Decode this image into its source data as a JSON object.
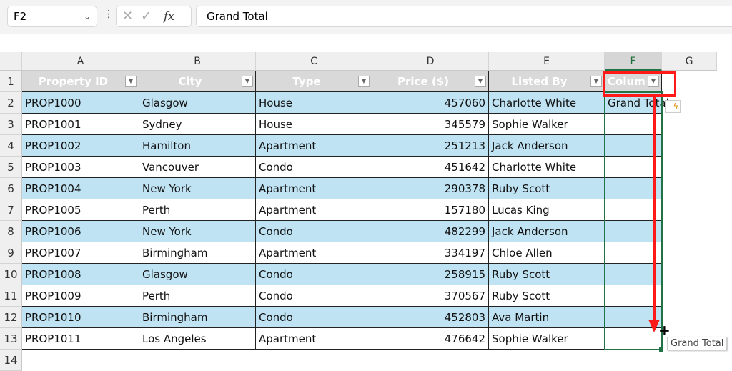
{
  "formula_bar": {
    "name_box": "F2",
    "formula": "Grand Total",
    "cancel_icon": "✕",
    "enter_icon": "✓",
    "fx_label": "fx"
  },
  "columns": [
    "A",
    "B",
    "C",
    "D",
    "E",
    "F",
    "G"
  ],
  "headers": [
    "Property ID",
    "City",
    "Type",
    "Price ($)",
    "Listed By",
    "Colum"
  ],
  "rows": [
    [
      "PROP1000",
      "Glasgow",
      "House",
      "457060",
      "Charlotte White",
      "Grand Total"
    ],
    [
      "PROP1001",
      "Sydney",
      "House",
      "345579",
      "Sophie Walker",
      ""
    ],
    [
      "PROP1002",
      "Hamilton",
      "Apartment",
      "251213",
      "Jack Anderson",
      ""
    ],
    [
      "PROP1003",
      "Vancouver",
      "Condo",
      "451642",
      "Charlotte White",
      ""
    ],
    [
      "PROP1004",
      "New York",
      "Apartment",
      "290378",
      "Ruby Scott",
      ""
    ],
    [
      "PROP1005",
      "Perth",
      "Apartment",
      "157180",
      "Lucas King",
      ""
    ],
    [
      "PROP1006",
      "New York",
      "Condo",
      "482299",
      "Jack Anderson",
      ""
    ],
    [
      "PROP1007",
      "Birmingham",
      "Apartment",
      "334197",
      "Chloe Allen",
      ""
    ],
    [
      "PROP1008",
      "Glasgow",
      "Condo",
      "258915",
      "Ruby Scott",
      ""
    ],
    [
      "PROP1009",
      "Perth",
      "Condo",
      "370567",
      "Ruby Scott",
      ""
    ],
    [
      "PROP1010",
      "Birmingham",
      "Condo",
      "452803",
      "Ava Martin",
      ""
    ],
    [
      "PROP1011",
      "Los Angeles",
      "Apartment",
      "476642",
      "Sophie Walker",
      ""
    ]
  ],
  "row_numbers": [
    "1",
    "2",
    "3",
    "4",
    "5",
    "6",
    "7",
    "8",
    "9",
    "10",
    "11",
    "12",
    "13",
    "14"
  ],
  "tooltip": "Grand Total",
  "colors": {
    "accent": "#217346",
    "highlight": "#ff0000",
    "band": "#bfe3f3"
  }
}
